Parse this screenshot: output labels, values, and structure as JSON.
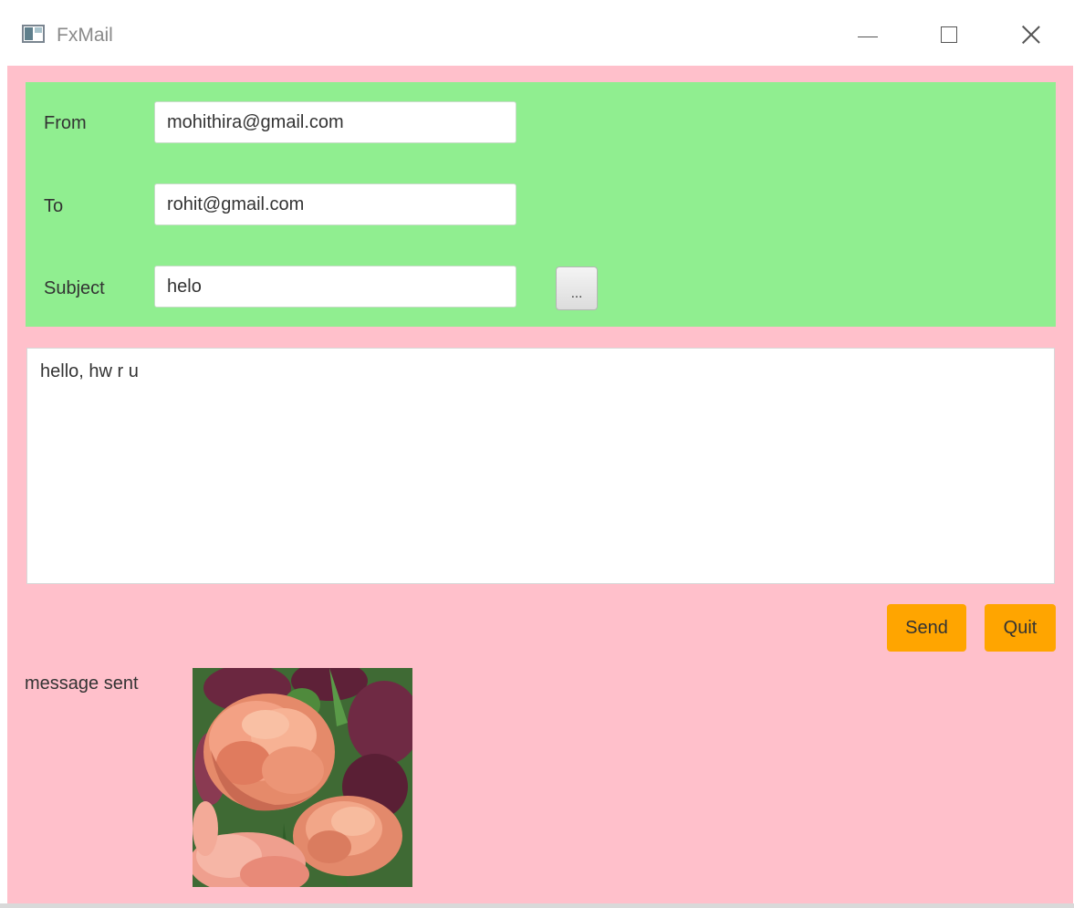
{
  "window": {
    "title": "FxMail",
    "icons": {
      "app": "app-window-icon",
      "minimize": "minimize-icon",
      "maximize": "maximize-icon",
      "close": "close-icon"
    }
  },
  "colors": {
    "background": "#ffc0cb",
    "header_pane": "#90ee90",
    "action_buttons": "#ffa500"
  },
  "form": {
    "from_label": "From",
    "from_value": "mohithira@gmail.com",
    "to_label": "To",
    "to_value": "rohit@gmail.com",
    "subject_label": "Subject",
    "subject_value": "helo",
    "browse_label": "..."
  },
  "message": {
    "body": "hello, hw r u"
  },
  "actions": {
    "send_label": "Send",
    "quit_label": "Quit"
  },
  "status": {
    "text": "message sent"
  },
  "image": {
    "subject": "peony-style pink tulips photo"
  }
}
